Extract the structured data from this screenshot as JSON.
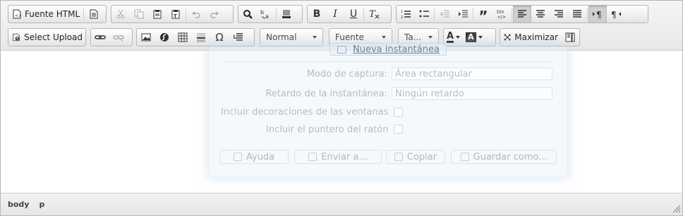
{
  "toolbar": {
    "source_label": "Fuente HTML",
    "upload_label": "Select Upload",
    "format_combo": "Normal",
    "font_combo": "Fuente",
    "size_combo": "Ta...",
    "text_color_glyph": "A",
    "bg_color_glyph": "A",
    "maximize_label": "Maximizar",
    "div_glyph": "DIV"
  },
  "screenshot_overlay": {
    "new_snapshot": "Nueva instantánea",
    "capture_mode_label": "Modo de captura:",
    "capture_mode_value": "Área rectangular",
    "delay_label": "Retardo de la instantánea:",
    "delay_value": "Ningún retardo",
    "include_decorations": "Incluir decoraciones de las ventanas",
    "include_pointer": "Incluir el puntero del ratón",
    "buttons": [
      "Ayuda",
      "Enviar a...",
      "Copiar",
      "Guardar como..."
    ]
  },
  "footer": {
    "path": [
      "body",
      "p"
    ]
  }
}
